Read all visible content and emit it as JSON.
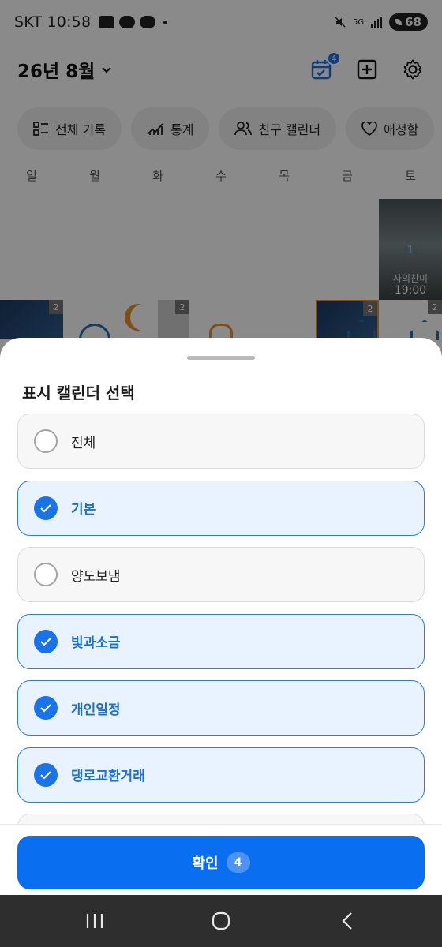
{
  "status_bar": {
    "carrier_time": "SKT 10:58",
    "battery": "68",
    "network": "5G"
  },
  "header": {
    "month_title": "26년 8월",
    "calendar_badge": "4",
    "icons": [
      "calendar-check-icon",
      "add-square-icon",
      "settings-gear-icon"
    ]
  },
  "chips": [
    {
      "label": "전체 기록",
      "icon": "list-icon"
    },
    {
      "label": "통계",
      "icon": "chart-icon"
    },
    {
      "label": "친구 캘린더",
      "icon": "people-icon"
    },
    {
      "label": "애정함",
      "icon": "heart-icon"
    }
  ],
  "weekdays": [
    "일",
    "월",
    "화",
    "수",
    "목",
    "금",
    "토"
  ],
  "calendar_event": {
    "day": "1",
    "label": "사의찬미",
    "time": "19:00"
  },
  "thumb_counts": [
    "2",
    "2",
    "2",
    "2"
  ],
  "sheet": {
    "title": "표시 캘린더 선택",
    "options": [
      {
        "label": "전체",
        "checked": false
      },
      {
        "label": "기본",
        "checked": true
      },
      {
        "label": "양도보냄",
        "checked": false
      },
      {
        "label": "빛과소금",
        "checked": true
      },
      {
        "label": "개인일정",
        "checked": true
      },
      {
        "label": "댕로교환거래",
        "checked": true
      }
    ],
    "confirm_label": "확인",
    "confirm_count": "4"
  },
  "colors": {
    "accent": "#0a6ef0",
    "checked_bg": "#e9f2ff",
    "checked_text": "#1a6fd8",
    "overlay": "rgba(0,0,0,0.46)"
  }
}
